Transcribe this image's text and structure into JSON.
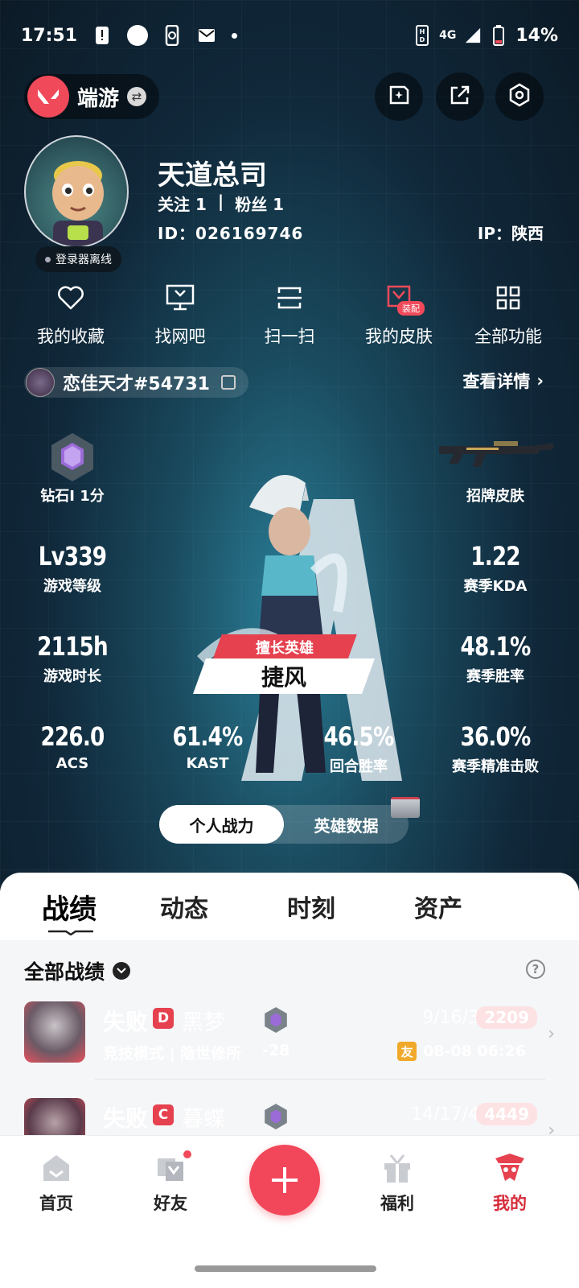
{
  "status_bar": {
    "time": "17:51",
    "network": "4G",
    "battery": "14%"
  },
  "header": {
    "app_name": "端游",
    "icons": [
      "edit-icon",
      "share-icon",
      "settings-icon"
    ]
  },
  "profile": {
    "nickname": "天道总司",
    "following": "关注 1",
    "separator": "|",
    "followers": "粉丝 1",
    "id": "ID：026169746",
    "ip": "IP：陕西",
    "launcher_status": "登录器离线"
  },
  "quick_actions": [
    {
      "label": "我的收藏",
      "icon": "heart-icon"
    },
    {
      "label": "找网吧",
      "icon": "monitor-icon"
    },
    {
      "label": "扫一扫",
      "icon": "scan-icon"
    },
    {
      "label": "我的皮肤",
      "icon": "skin-icon",
      "badge": "装配"
    },
    {
      "label": "全部功能",
      "icon": "grid-icon"
    }
  ],
  "riot_account": {
    "name": "恋佳天才#54731",
    "view_details": "查看详情"
  },
  "stats": {
    "rank": "钻石I 1分",
    "card_skin": "招牌皮肤",
    "level_value": "Lv339",
    "level_label": "游戏等级",
    "kda_value": "1.22",
    "kda_label": "赛季KDA",
    "hours_value": "2115h",
    "hours_label": "游戏时长",
    "winrate_value": "48.1%",
    "winrate_label": "赛季胜率",
    "acs_value": "226.0",
    "acs_label": "ACS",
    "kast_value": "61.4%",
    "kast_label": "KAST",
    "round_win_value": "46.5%",
    "round_win_label": "回合胜率",
    "precise_value": "36.0%",
    "precise_label": "赛季精准击败"
  },
  "favorite_hero": {
    "tag": "擅长英雄",
    "name": "捷风"
  },
  "segment": {
    "personal": "个人战力",
    "hero": "英雄数据"
  },
  "tabs": [
    "战绩",
    "动态",
    "时刻",
    "资产"
  ],
  "list": {
    "filter_label": "全部战绩",
    "matches": [
      {
        "result": "失败",
        "tier": "D",
        "tier_color": "#e5414f",
        "map": "黑梦",
        "mode": "竞技模式 | 隐世修所",
        "rr_delta": "-28",
        "kda": "9/16/3",
        "acs": "2209",
        "friend_tag": "友",
        "date": "08-08 06:26"
      },
      {
        "result": "失败",
        "tier": "C",
        "tier_color": "#e5414f",
        "map": "暮蝶",
        "kda": "14/17/4",
        "acs": "4449"
      }
    ]
  },
  "bottom_nav": [
    {
      "label": "首页",
      "icon": "home-icon"
    },
    {
      "label": "好友",
      "icon": "friends-icon"
    },
    {
      "label": "福利",
      "icon": "gift-icon"
    },
    {
      "label": "我的",
      "icon": "profile-icon",
      "active": true
    }
  ],
  "colors": {
    "accent": "#f2475a",
    "sheet_bg": "#f5f6f8"
  }
}
